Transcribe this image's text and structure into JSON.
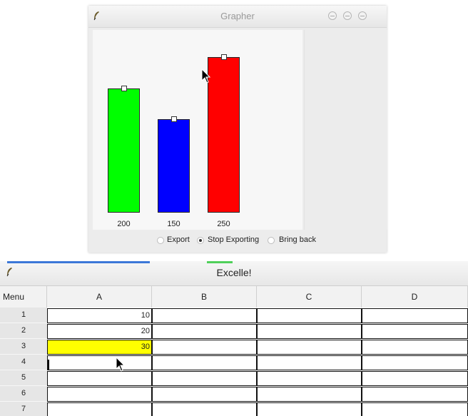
{
  "grapher": {
    "title": "Grapher",
    "bars": [
      {
        "value": 200,
        "label": "200",
        "color": "#00ff00"
      },
      {
        "value": 150,
        "label": "150",
        "color": "#0000ff"
      },
      {
        "value": 250,
        "label": "250",
        "color": "#ff0000"
      }
    ],
    "export_options": [
      {
        "label": "Export",
        "checked": false
      },
      {
        "label": "Stop Exporting",
        "checked": true
      },
      {
        "label": "Bring back",
        "checked": false
      }
    ]
  },
  "excel": {
    "title": "Excelle!",
    "corner_label": "Menu",
    "columns": [
      "A",
      "B",
      "C",
      "D"
    ],
    "rows": [
      {
        "num": "1",
        "cells": [
          "10",
          "",
          "",
          ""
        ]
      },
      {
        "num": "2",
        "cells": [
          "20",
          "",
          "",
          ""
        ]
      },
      {
        "num": "3",
        "cells": [
          "30",
          "",
          "",
          ""
        ]
      },
      {
        "num": "4",
        "cells": [
          "",
          "",
          "",
          ""
        ]
      },
      {
        "num": "5",
        "cells": [
          "",
          "",
          "",
          ""
        ]
      },
      {
        "num": "6",
        "cells": [
          "",
          "",
          "",
          ""
        ]
      },
      {
        "num": "7",
        "cells": [
          "",
          "",
          "",
          ""
        ]
      }
    ],
    "highlight_color": "#ffff00"
  }
}
